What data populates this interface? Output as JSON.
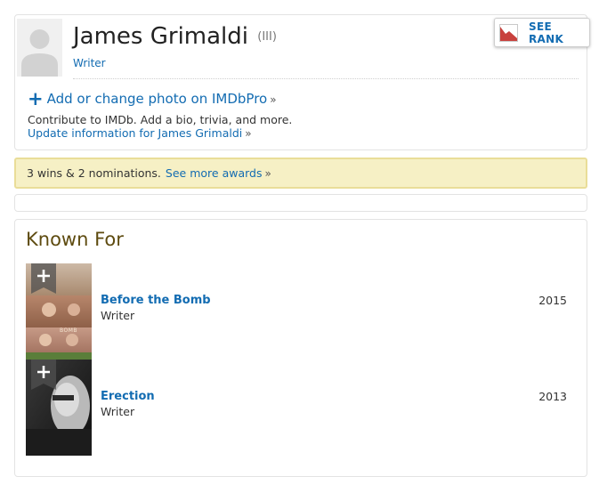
{
  "person": {
    "name": "James Grimaldi",
    "suffix": "(III)",
    "role": "Writer"
  },
  "rank_button": {
    "label": "SEE RANK"
  },
  "photo": {
    "plus": "+",
    "label": "Add or change photo on IMDbPro",
    "raquo": "»"
  },
  "contribute": {
    "text": "Contribute to IMDb. Add a bio, trivia, and more.",
    "update_link": "Update information for James Grimaldi",
    "raquo": "»"
  },
  "awards": {
    "text": "3 wins & 2 nominations.",
    "link": "See more awards",
    "raquo": "»"
  },
  "known_for": {
    "title": "Known For",
    "items": [
      {
        "title": "Before the Bomb",
        "role": "Writer",
        "year": "2015",
        "poster_text": "BOMB"
      },
      {
        "title": "Erection",
        "role": "Writer",
        "year": "2013"
      }
    ]
  },
  "colors": {
    "link": "#136cb2",
    "awards_bg": "#f6f0c5",
    "awards_border": "#e9dd98",
    "known_for_title": "#5e4b10"
  },
  "icons": [
    "avatar-placeholder-icon",
    "rank-chart-icon",
    "plus-icon",
    "add-to-watchlist-ribbon-icon"
  ]
}
